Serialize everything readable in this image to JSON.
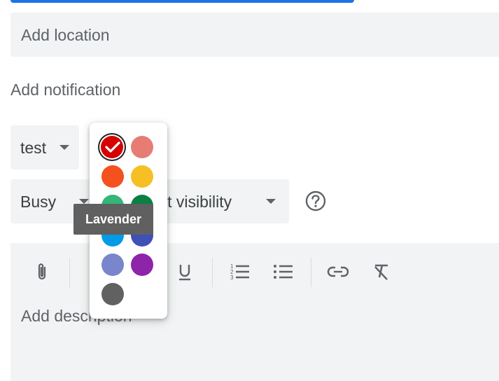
{
  "location": {
    "placeholder": "Add location"
  },
  "notification": {
    "label": "Add notification"
  },
  "calendar_select": {
    "value": "test"
  },
  "status_select": {
    "value": "Busy"
  },
  "visibility_select": {
    "value": "lt visibility"
  },
  "description": {
    "placeholder": "Add description"
  },
  "toolbar": {
    "icons": [
      "attachment-icon",
      "underline-icon",
      "numbered-list-icon",
      "bulleted-list-icon",
      "link-icon",
      "remove-formatting-icon"
    ],
    "underline_label": "U"
  },
  "palette": {
    "colors": [
      {
        "name": "Tomato",
        "hex": "#d50000",
        "selected": true
      },
      {
        "name": "Flamingo",
        "hex": "#e67c73"
      },
      {
        "name": "Tangerine",
        "hex": "#f4511e"
      },
      {
        "name": "Banana",
        "hex": "#f6bf26"
      },
      {
        "name": "Sage",
        "hex": "#33b679"
      },
      {
        "name": "Basil",
        "hex": "#0b8043"
      },
      {
        "name": "Peacock",
        "hex": "#039be5"
      },
      {
        "name": "Blueberry",
        "hex": "#3f51b5"
      },
      {
        "name": "Lavender",
        "hex": "#7986cb"
      },
      {
        "name": "Grape",
        "hex": "#8e24aa"
      },
      {
        "name": "Graphite",
        "hex": "#616161"
      }
    ],
    "tooltip": "Lavender"
  },
  "accent_color": "#1a73e8"
}
